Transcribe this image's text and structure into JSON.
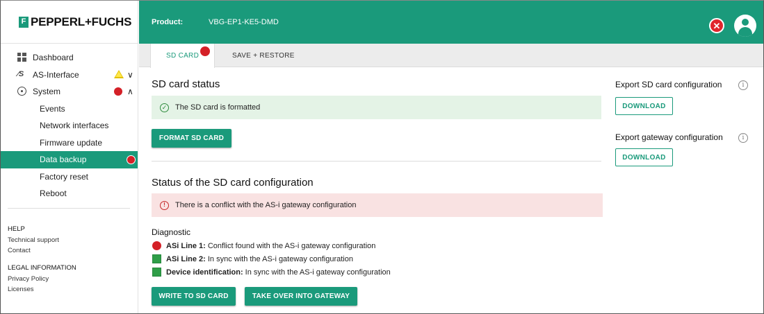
{
  "brand": {
    "logo_text": "PEPPERL+FUCHS",
    "logo_mark": "F",
    "accent_color": "#1a9a7b"
  },
  "header": {
    "product_label": "Product:",
    "product_value": "VBG-EP1-KE5-DMD"
  },
  "sidebar": {
    "items": [
      {
        "label": "Dashboard",
        "icon": "dashboard-icon"
      },
      {
        "label": "AS-Interface",
        "icon": "asi-icon",
        "status": "warning"
      },
      {
        "label": "System",
        "icon": "system-icon",
        "status": "error",
        "expanded": true
      },
      {
        "label": "Events"
      },
      {
        "label": "Network interfaces"
      },
      {
        "label": "Firmware update"
      },
      {
        "label": "Data backup",
        "active": true,
        "status": "error"
      },
      {
        "label": "Factory reset"
      },
      {
        "label": "Reboot"
      }
    ],
    "help": {
      "heading": "HELP",
      "links": [
        "Technical support",
        "Contact"
      ]
    },
    "legal": {
      "heading": "LEGAL INFORMATION",
      "links": [
        "Privacy Policy",
        "Licenses"
      ]
    }
  },
  "tabs": [
    {
      "label": "SD CARD",
      "active": true,
      "status": "error"
    },
    {
      "label": "SAVE + RESTORE",
      "active": false
    }
  ],
  "sd_status": {
    "title": "SD card status",
    "message": "The SD card is formatted",
    "format_button": "FORMAT SD CARD"
  },
  "sd_config": {
    "title": "Status of the SD card configuration",
    "message": "There is a conflict with the AS-i gateway configuration",
    "diagnostic_title": "Diagnostic",
    "rows": [
      {
        "name": "ASi Line 1:",
        "text": "Conflict found with the AS-i gateway configuration",
        "status": "error"
      },
      {
        "name": "ASi Line 2:",
        "text": "In sync with the AS-i gateway configuration",
        "status": "ok"
      },
      {
        "name": "Device identification:",
        "text": "In sync with the AS-i gateway configuration",
        "status": "ok"
      }
    ],
    "write_button": "WRITE TO SD CARD",
    "takeover_button": "TAKE OVER INTO GATEWAY"
  },
  "export": {
    "sd_title": "Export SD card configuration",
    "sd_download": "DOWNLOAD",
    "gw_title": "Export gateway configuration",
    "gw_download": "DOWNLOAD"
  },
  "colors": {
    "error": "#d42027",
    "warning": "#ffe74a",
    "ok": "#2f9e48"
  }
}
